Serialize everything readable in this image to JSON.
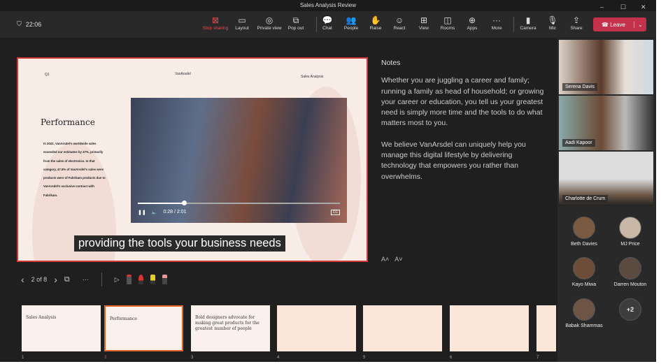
{
  "window": {
    "title": "Sales Analysis Review",
    "controls": [
      "–",
      "☐",
      "✕"
    ]
  },
  "toolbar": {
    "timer": "22:06",
    "buttons": [
      {
        "label": "Stop sharing",
        "icon": "stop-sharing-icon",
        "glyph": "⊠"
      },
      {
        "label": "Layout",
        "icon": "layout-icon",
        "glyph": "▭"
      },
      {
        "label": "Private view",
        "icon": "private-view-icon",
        "glyph": "◎"
      },
      {
        "label": "Pop out",
        "icon": "pop-out-icon",
        "glyph": "⧉"
      },
      {
        "label": "Chat",
        "icon": "chat-icon",
        "glyph": "💬"
      },
      {
        "label": "People",
        "icon": "people-icon",
        "glyph": "👥"
      },
      {
        "label": "Raise",
        "icon": "raise-hand-icon",
        "glyph": "✋"
      },
      {
        "label": "React",
        "icon": "react-icon",
        "glyph": "☺"
      },
      {
        "label": "View",
        "icon": "view-icon",
        "glyph": "⊞"
      },
      {
        "label": "Rooms",
        "icon": "rooms-icon",
        "glyph": "◫"
      },
      {
        "label": "Apps",
        "icon": "apps-icon",
        "glyph": "⊕"
      },
      {
        "label": "More",
        "icon": "more-icon",
        "glyph": "···"
      },
      {
        "label": "Camera",
        "icon": "camera-off-icon",
        "glyph": "▮"
      },
      {
        "label": "Mic",
        "icon": "mic-icon",
        "glyph": "🎙"
      },
      {
        "label": "Share",
        "icon": "share-icon",
        "glyph": "⇪"
      }
    ],
    "leave": "Leave",
    "accent": "#c4314b"
  },
  "slide": {
    "quarter": "Q1",
    "brand": "VanArsdel",
    "section": "Sales Analysis",
    "title": "Performance",
    "body": "In 2022, VanArsdel's worldwide sales exceeded our estimates by 47%, primarily from the sales of electronics. In that category, 47.5% of VanArsdel's sales were products were of Fabrikam products due to VanArsdel's exclusive contract with Fabrikam.",
    "video": {
      "time": "0:28 / 2:01",
      "progress": 0.23,
      "cc": "CC"
    },
    "caption": "providing the tools your business needs"
  },
  "notes": {
    "heading": "Notes",
    "paragraphs": [
      "Whether you are juggling a career and family; running a family as head of household; or growing your career or education, you tell us your greatest need is simply more time and the tools to do what matters most to you.",
      "We believe VanArsdel can uniquely help you manage this digital lifestyle by delivering technology that empowers you rather than overwhelms."
    ],
    "increase_font": "A˄",
    "decrease_font": "A˅"
  },
  "nav": {
    "page": "2 of 8",
    "more": "···"
  },
  "thumbnails": [
    {
      "num": "1",
      "title": "Sales Analysis"
    },
    {
      "num": "2",
      "title": "Performance"
    },
    {
      "num": "3",
      "title": "Bold designers advocate for making great products for the greatest number of people"
    },
    {
      "num": "4",
      "title": ""
    },
    {
      "num": "5",
      "title": ""
    },
    {
      "num": "6",
      "title": ""
    },
    {
      "num": "7",
      "title": ""
    }
  ],
  "participants": {
    "video": [
      "Serena Davis",
      "Aadi Kapoor",
      "Charlotte de Crum"
    ],
    "avatars": [
      "Beth Davies",
      "MJ Price",
      "Kayo Miwa",
      "Darren Mouton",
      "Babak Shammas"
    ],
    "overflow": "+2"
  }
}
